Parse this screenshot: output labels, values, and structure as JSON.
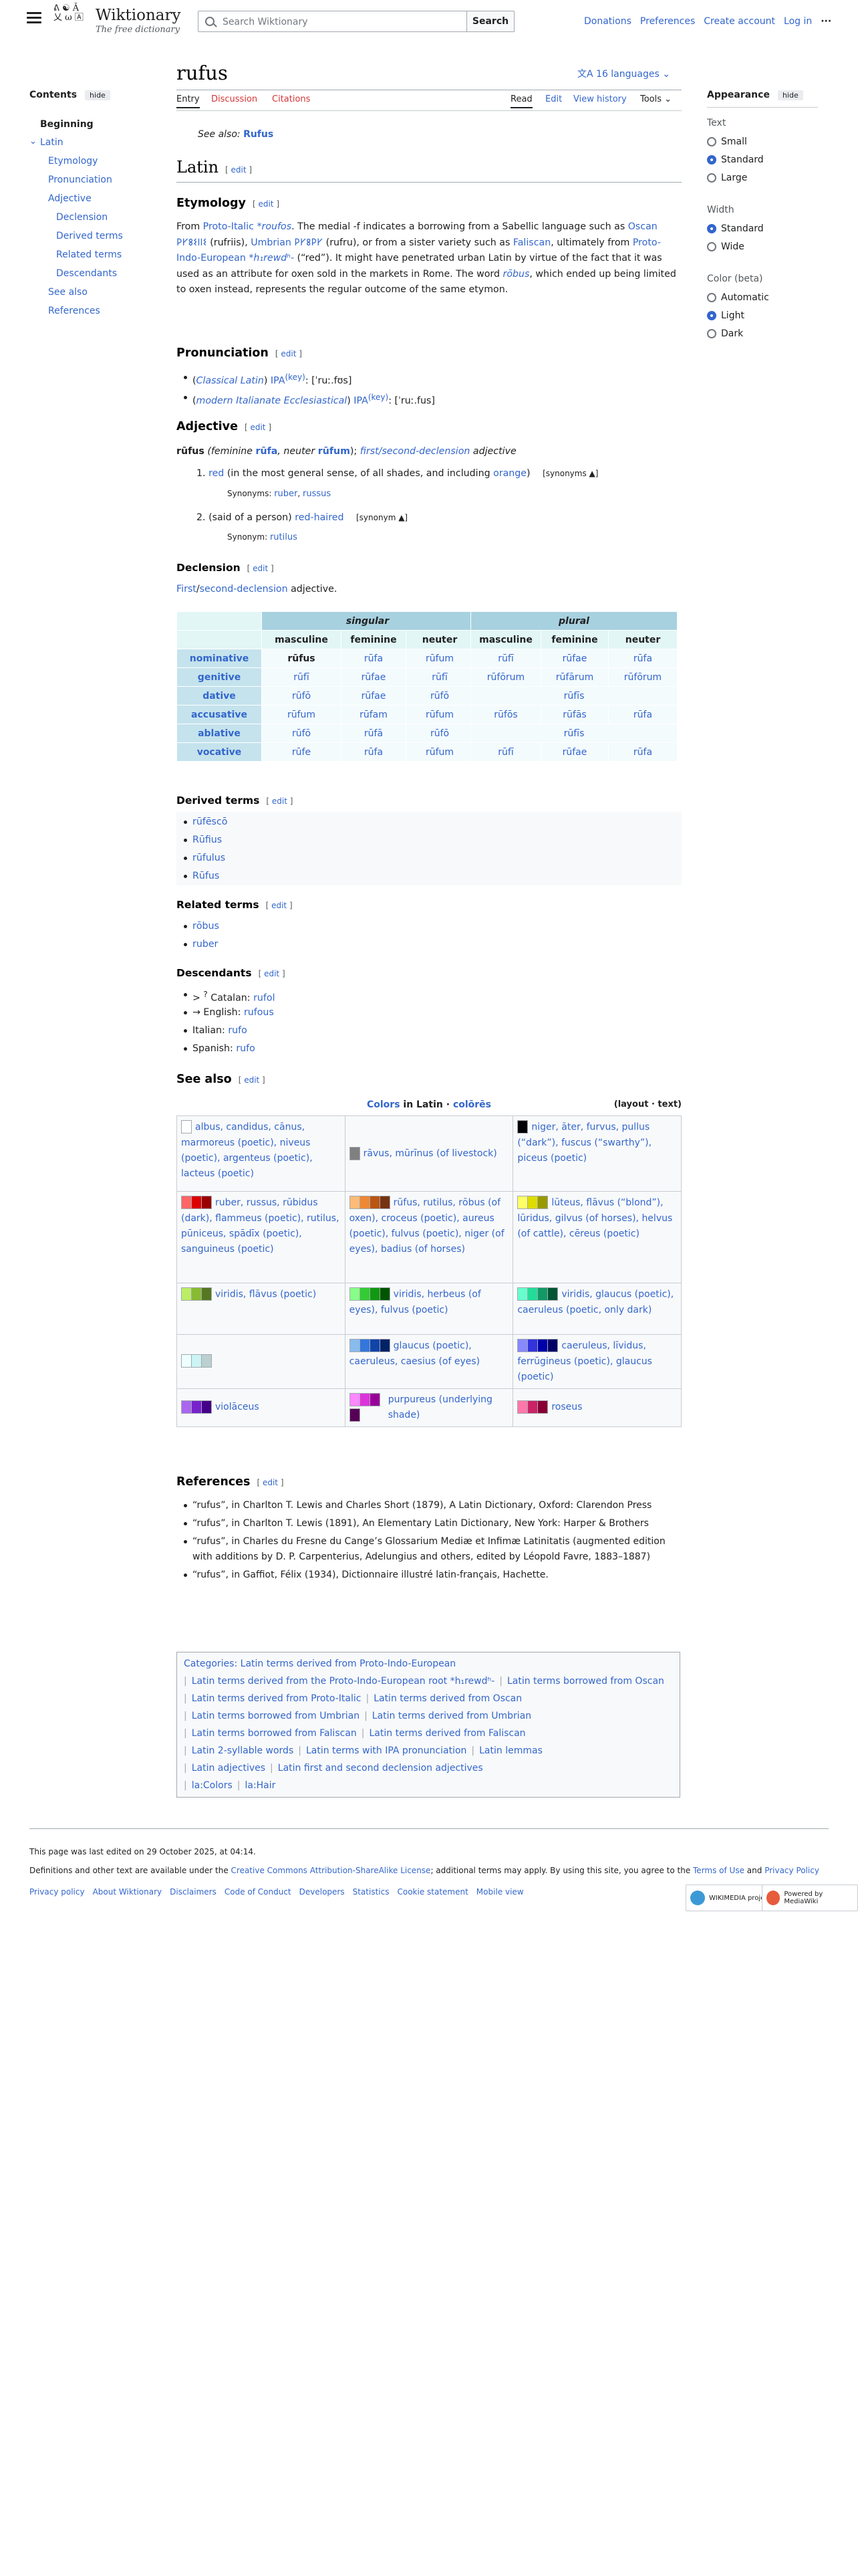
{
  "header": {
    "site_name": "Wiktionary",
    "tagline": "The free dictionary",
    "logo_glyphs": "ᕕ ☯ Ǎ 乂 ω 🄰",
    "search_placeholder": "Search Wiktionary",
    "search_button": "Search",
    "top_links": [
      "Donations",
      "Preferences",
      "Create account",
      "Log in"
    ],
    "more_icon": "ellipsis-icon"
  },
  "toc": {
    "title": "Contents",
    "hide": "hide",
    "items": [
      "Beginning",
      "Latin",
      "Etymology",
      "Pronunciation",
      "Adjective",
      "Declension",
      "Derived terms",
      "Related terms",
      "Descendants",
      "See also",
      "References"
    ]
  },
  "page": {
    "title": "rufus",
    "languages": "16 languages",
    "tabs_left": [
      "Entry",
      "Discussion",
      "Citations"
    ],
    "tabs_right": [
      "Read",
      "Edit",
      "View history",
      "Tools"
    ],
    "see_also_label": "See also:",
    "see_also_link": "Rufus",
    "lang_heading": "Latin",
    "edit": "edit"
  },
  "etymology": {
    "heading": "Etymology",
    "text": [
      "From ",
      "Proto-Italic",
      " *roufos",
      ". The medial -f indicates a borrowing from a Sabellic language such as ",
      "Oscan",
      " 𐌓𐌖𐌚𐌔𐌉𐌉𐌔",
      " (rufriis), ",
      "Umbrian",
      " 𐌓𐌖𐌚𐌓𐌖",
      " (rufru), or from a sister variety such as ",
      "Faliscan",
      ", ultimately from ",
      "Proto-Indo-European",
      " *h₁rewdʰ-",
      " (“red”). It might have penetrated urban Latin by virtue of the fact that it was used as an attribute for oxen sold in the markets in Rome. The word ",
      "rōbus",
      ", which ended up being limited to oxen instead, represents the regular outcome of the same etymon."
    ]
  },
  "pronunciation": {
    "heading": "Pronunciation",
    "items": [
      {
        "variety": "Classical Latin",
        "ipa_label": "IPA",
        "key": "(key)",
        "ipa": ": [ˈruː.fʊs]"
      },
      {
        "variety": "modern Italianate Ecclesiastical",
        "ipa_label": "IPA",
        "key": "(key)",
        "ipa": ": [ˈruː.fus]"
      }
    ]
  },
  "adjective": {
    "heading": "Adjective",
    "headword": "rūfus",
    "forms": [
      "(feminine ",
      "rūfa",
      ", neuter ",
      "rūfum",
      "); ",
      "first/second-declension",
      " adjective"
    ],
    "senses": [
      {
        "n": "1.",
        "link": "red",
        "text": " (in the most general sense, of all shades, and including ",
        "link2": "orange",
        "tail": ")",
        "toggle": "[synonyms ▲]",
        "syn_label": "Synonyms:",
        "syns": [
          "ruber",
          "russus"
        ]
      },
      {
        "n": "2.",
        "text_pre": "(said of a person) ",
        "link": "red-haired",
        "toggle": "[synonym ▲]",
        "syn_label": "Synonym:",
        "syns": [
          "rutilus"
        ]
      }
    ]
  },
  "declension": {
    "heading": "Declension",
    "intro_link": "First",
    "intro_link2": "second-declension",
    "intro_tail": " adjective.",
    "singular": "singular",
    "plural": "plural",
    "genders": [
      "masculine",
      "feminine",
      "neuter"
    ],
    "cases": [
      "nominative",
      "genitive",
      "dative",
      "accusative",
      "ablative",
      "vocative"
    ],
    "sg": [
      [
        "rūfus",
        "rūfa",
        "rūfum"
      ],
      [
        "rūfī",
        "rūfae",
        "rūfī"
      ],
      [
        "rūfō",
        "rūfae",
        "rūfō"
      ],
      [
        "rūfum",
        "rūfam",
        "rūfum"
      ],
      [
        "rūfō",
        "rūfā",
        "rūfō"
      ],
      [
        "rūfe",
        "rūfa",
        "rūfum"
      ]
    ],
    "pl": [
      [
        "rūfī",
        "rūfae",
        "rūfa"
      ],
      [
        "rūfōrum",
        "rūfārum",
        "rūfōrum"
      ],
      [
        "rūfīs"
      ],
      [
        "rūfōs",
        "rūfās",
        "rūfa"
      ],
      [
        "rūfīs"
      ],
      [
        "rūfī",
        "rūfae",
        "rūfa"
      ]
    ]
  },
  "derived": {
    "heading": "Derived terms",
    "items": [
      "rūfēscō",
      "Rūfius",
      "rūfulus",
      "Rūfus"
    ]
  },
  "related": {
    "heading": "Related terms",
    "items": [
      "rōbus",
      "ruber"
    ]
  },
  "descendants": {
    "heading": "Descendants",
    "items": [
      {
        "pre": "> ",
        "sup": "?",
        "lang": " Catalan: ",
        "word": "rufol"
      },
      {
        "pre": "→ ",
        "lang": "English: ",
        "word": "rufous"
      },
      {
        "pre": "",
        "lang": "Italian: ",
        "word": "rufo"
      },
      {
        "pre": "",
        "lang": "Spanish: ",
        "word": "rufo"
      }
    ]
  },
  "see_also": {
    "heading": "See also",
    "table_title_1": "Colors",
    "table_title_2": " in Latin · ",
    "table_title_3": "colōrēs",
    "layout_text": "(layout · text)",
    "cells": [
      [
        {
          "colors": [
            "#ffffff"
          ],
          "text": "albus, candidus, cānus, marmoreus (poetic), niveus (poetic), argenteus (poetic), lacteus (poetic)"
        },
        {
          "colors": [
            "#808080"
          ],
          "text": "rāvus, mūrīnus (of livestock)"
        },
        {
          "colors": [
            "#000000"
          ],
          "text": "niger, āter, furvus, pullus (“dark”), fuscus (“swarthy”), piceus (poetic)"
        }
      ],
      [
        {
          "colors": [
            "#ff6666",
            "#dd0000",
            "#990000"
          ],
          "text": "ruber, russus, rūbidus (dark), flammeus (poetic), rutilus, pūniceus, spādīx (poetic), sanguineus (poetic)"
        },
        {
          "colors": [
            "#ffbb77",
            "#ee8833",
            "#bb5511",
            "#773311"
          ],
          "text": "rūfus, rutilus, rōbus (of oxen), croceus (poetic), aureus (poetic), fulvus (poetic), niger (of eyes), badius (of horses)"
        },
        {
          "colors": [
            "#ffff66",
            "#dddd00",
            "#999900"
          ],
          "text": "lūteus, flāvus (“blond”), lūridus, gilvus (of horses), helvus (of cattle), cēreus (poetic)"
        }
      ],
      [
        {
          "colors": [
            "#bbee66",
            "#88bb33",
            "#557722"
          ],
          "text": "viridis, flāvus (poetic)"
        },
        {
          "colors": [
            "#88ff88",
            "#33cc33",
            "#119911",
            "#005500"
          ],
          "text": "viridis, herbeus (of eyes), fulvus (poetic)"
        },
        {
          "colors": [
            "#66ffcc",
            "#22dd99",
            "#119966",
            "#005533"
          ],
          "text": "viridis, glaucus (poetic), caeruleus (poetic, only dark)"
        }
      ],
      [
        {
          "colors": [
            "#eeffff",
            "#ccf4f4",
            "#bbd0d0"
          ],
          "text": ""
        },
        {
          "colors": [
            "#88bbee",
            "#3377dd",
            "#1144aa",
            "#002266"
          ],
          "text": "glaucus (poetic), caeruleus, caesius (of eyes)"
        },
        {
          "colors": [
            "#8888ff",
            "#3333dd",
            "#0000aa",
            "#000066"
          ],
          "text": "caeruleus, līvidus, ferrūgineus (poetic), glaucus (poetic)"
        }
      ],
      [
        {
          "colors": [
            "#aa66ee",
            "#7722cc",
            "#440088"
          ],
          "text": "violāceus"
        },
        {
          "colors": [
            "#ff88ff",
            "#dd33dd",
            "#990099",
            "#550055"
          ],
          "text": "purpureus (underlying shade)"
        },
        {
          "colors": [
            "#ff77aa",
            "#cc2266",
            "#880033"
          ],
          "text": "roseus"
        }
      ]
    ]
  },
  "references": {
    "heading": "References",
    "items": [
      "“rufus”, in Charlton T. Lewis and Charles Short (1879), A Latin Dictionary, Oxford: Clarendon Press",
      "“rufus”, in Charlton T. Lewis (1891), An Elementary Latin Dictionary, New York: Harper & Brothers",
      "“rufus”, in Charles du Fresne du Cange’s Glossarium Mediæ et Infimæ Latinitatis (augmented edition with additions by D. P. Carpenterius, Adelungius and others, edited by Léopold Favre, 1883–1887)",
      "“rufus”, in Gaffiot, Félix (1934), Dictionnaire illustré latin-français, Hachette."
    ]
  },
  "categories": {
    "label": "Categories:",
    "items": [
      "Latin terms derived from Proto-Indo-European",
      "Latin terms derived from the Proto-Indo-European root *h₁rewdʰ-",
      "Latin terms borrowed from Oscan",
      "Latin terms derived from Proto-Italic",
      "Latin terms derived from Oscan",
      "Latin terms borrowed from Umbrian",
      "Latin terms derived from Umbrian",
      "Latin terms borrowed from Faliscan",
      "Latin terms derived from Faliscan",
      "Latin 2-syllable words",
      "Latin terms with IPA pronunciation",
      "Latin lemmas",
      "Latin adjectives",
      "Latin first and second declension adjectives",
      "la:Colors",
      "la:Hair"
    ]
  },
  "appearance": {
    "title": "Appearance",
    "hide": "hide",
    "text_label": "Text",
    "text_opts": [
      "Small",
      "Standard",
      "Large"
    ],
    "text_selected": 1,
    "width_label": "Width",
    "width_opts": [
      "Standard",
      "Wide"
    ],
    "width_selected": 0,
    "color_label": "Color (beta)",
    "color_opts": [
      "Automatic",
      "Light",
      "Dark"
    ],
    "color_selected": 1
  },
  "footer": {
    "edited": "This page was last edited on 29 October 2025, at 04:14.",
    "license_pre": "Definitions and other text are available under the ",
    "license_link": "Creative Commons Attribution-ShareAlike License",
    "license_mid": "; additional terms may apply. By using this site, you agree to the ",
    "terms": "Terms of Use",
    "and": " and ",
    "privacy": "Privacy Policy",
    "links": [
      "Privacy policy",
      "About Wiktionary",
      "Disclaimers",
      "Code of Conduct",
      "Developers",
      "Statistics",
      "Cookie statement",
      "Mobile view"
    ],
    "badge1": "WIKIMEDIA project",
    "badge2": "Powered by MediaWiki"
  }
}
